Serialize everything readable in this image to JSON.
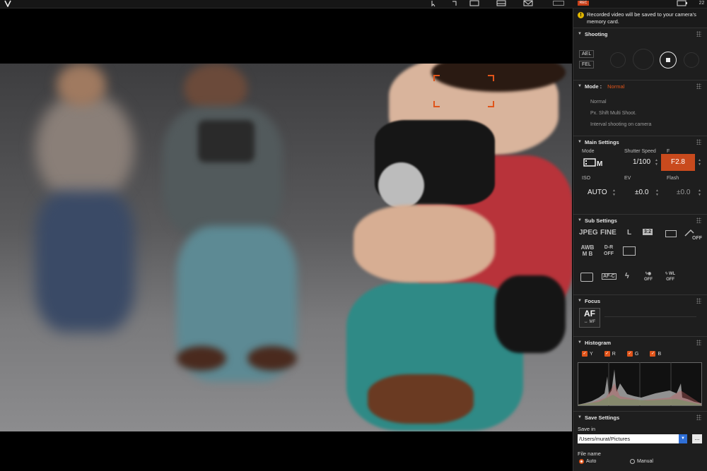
{
  "toolbar": {
    "icons": [
      "app-logo-icon",
      "zoom-cursor-icon",
      "live-view-icon",
      "grid-icon",
      "mail-icon",
      "view-mode-icon",
      "record-indicator-icon",
      "battery-icon"
    ],
    "rec_label": "REC",
    "battery_text": "22"
  },
  "notice": {
    "text": "Recorded video will be saved to your camera's memory card."
  },
  "shooting": {
    "title": "Shooting",
    "ael": "AEL",
    "fel": "FEL"
  },
  "mode": {
    "title": "Mode :",
    "current": "Normal",
    "options": [
      "Normal",
      "Px. Shift Multi Shoot.",
      "Interval shooting on camera"
    ]
  },
  "main_settings": {
    "title": "Main Settings",
    "mode_label": "Mode",
    "shutter_label": "Shutter Speed",
    "shutter_value": "1/100",
    "f_label": "F",
    "f_value": "F2.8",
    "iso_label": "ISO",
    "iso_value": "AUTO",
    "ev_label": "EV",
    "ev_value": "±0.0",
    "flash_label": "Flash",
    "flash_value": "±0.0"
  },
  "sub_settings": {
    "title": "Sub Settings",
    "row1": [
      "JPEG",
      "FINE",
      "L",
      "3:2"
    ],
    "awb": "AWB",
    "dr": "D-R OFF",
    "afc": "AF-C",
    "off1": "OFF",
    "off2": "OFF",
    "wl": "WL",
    "off3": "OFF"
  },
  "focus": {
    "title": "Focus",
    "af_label": "AF",
    "mf_label": "MF"
  },
  "histogram": {
    "title": "Histogram",
    "channels": [
      "Y",
      "R",
      "G",
      "B"
    ]
  },
  "save_settings": {
    "title": "Save Settings",
    "save_in_label": "Save in",
    "path": "/Users/murat/Pictures",
    "browse": "...",
    "file_name_label": "File name",
    "auto_label": "Auto",
    "manual_label": "Manual"
  },
  "colors": {
    "accent": "#e0541a",
    "panel_bg": "#1e1e1e"
  }
}
